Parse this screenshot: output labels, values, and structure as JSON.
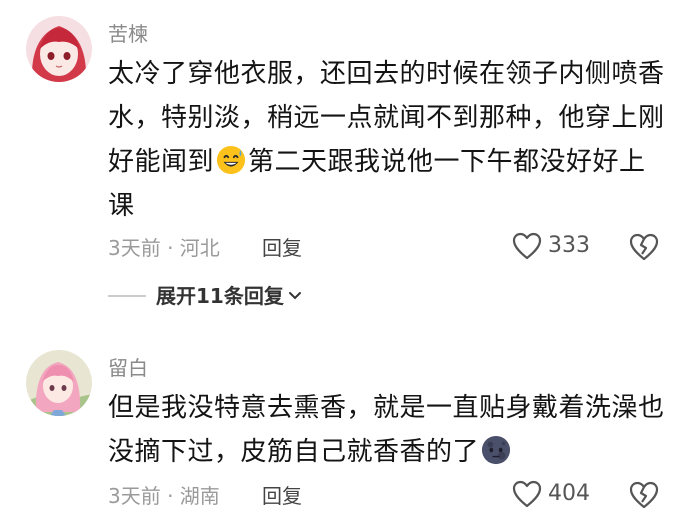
{
  "comments": [
    {
      "username": "苦楝",
      "lines": [
        "太冷了穿他衣服，还回去的时候在领子内侧喷香",
        "水，特别淡，稍远一点就闻不到那种，他穿上刚",
        "好能闻到",
        "第二天跟我说他一下午都没好好上",
        "课"
      ],
      "emoji": "grinning-sweat-emoji",
      "meta": "3天前 · 河北",
      "reply_label": "回复",
      "likes": "333",
      "expand_label": "展开11条回复"
    },
    {
      "username": "留白",
      "lines": [
        "但是我没特意去熏香，就是一直贴身戴着洗澡也",
        "没摘下过，皮筋自己就香香的了"
      ],
      "emoji": "dark-moon-face-emoji",
      "meta": "3天前 · 湖南",
      "reply_label": "回复",
      "likes": "404"
    }
  ],
  "colors": {
    "username": "#8a8a8a",
    "meta": "#9a9a9a",
    "text": "#141414"
  }
}
